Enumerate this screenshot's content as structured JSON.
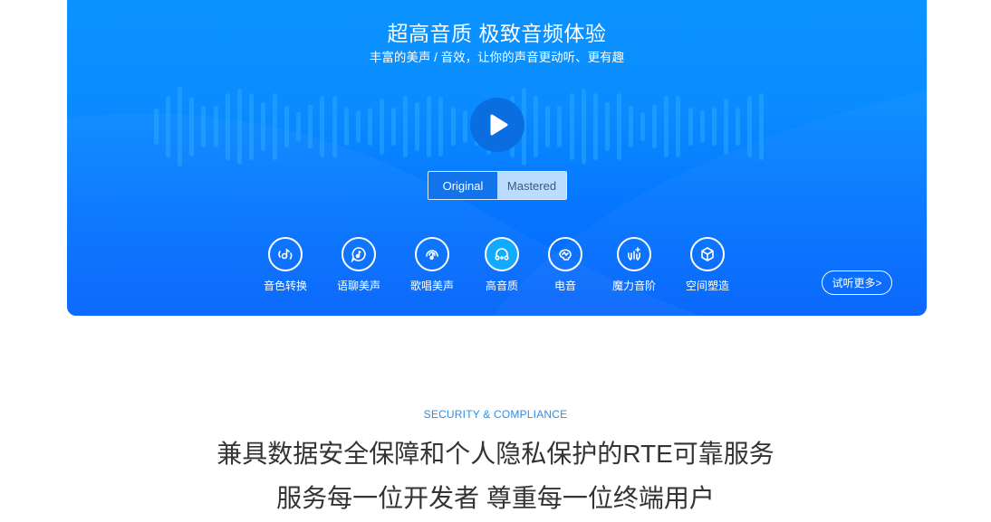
{
  "hero": {
    "title": "超高音质 极致音频体验",
    "subtitle": "丰富的美声 / 音效，让你的声音更动听、更有趣",
    "play_icon": "play-icon",
    "toggle": {
      "options": [
        "Original",
        "Mastered"
      ],
      "selected": "Original"
    },
    "features": [
      {
        "label": "音色转换",
        "icon": "voice-change-icon",
        "active": false
      },
      {
        "label": "语聊美声",
        "icon": "chat-voice-icon",
        "active": false
      },
      {
        "label": "歌唱美声",
        "icon": "singing-voice-icon",
        "active": false
      },
      {
        "label": "高音质",
        "icon": "headphones-icon",
        "active": true
      },
      {
        "label": "电音",
        "icon": "electronic-icon",
        "active": false
      },
      {
        "label": "魔力音阶",
        "icon": "magic-scale-icon",
        "active": false
      },
      {
        "label": "空间塑造",
        "icon": "cube-icon",
        "active": false
      }
    ],
    "more_button": "试听更多>",
    "colors": {
      "gradient_top": "#0b94ff",
      "gradient_bottom": "#0464fb",
      "active_feature": "#10aaff",
      "toggle_active": "#1273ea",
      "toggle_inactive": "#bcdcff"
    }
  },
  "section": {
    "eyebrow": "SECURITY & COMPLIANCE",
    "headline_line1": "兼具数据安全保障和个人隐私保护的RTE可靠服务",
    "headline_line2": "服务每一位开发者 尊重每一位终端用户",
    "colors": {
      "eyebrow": "#2b8ee8",
      "headline": "#333333"
    }
  }
}
